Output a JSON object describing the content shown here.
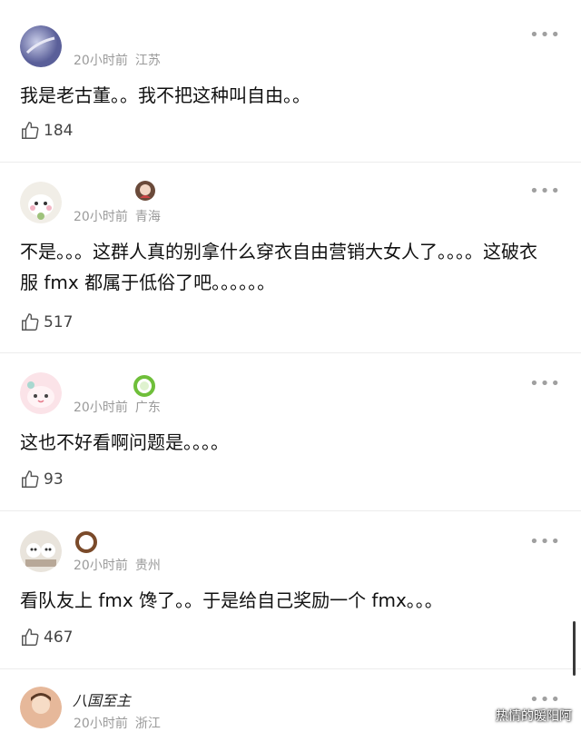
{
  "comments": [
    {
      "time": "20小时前",
      "location": "江苏",
      "text": "我是老古董。。我不把这种叫自由。。",
      "likes": "184",
      "more": "•••"
    },
    {
      "time": "20小时前",
      "location": "青海",
      "text": "不是。。。这群人真的别拿什么穿衣自由营销大女人了。。。。这破衣服 fmx 都属于低俗了吧。。。。。。",
      "likes": "517",
      "more": "•••"
    },
    {
      "time": "20小时前",
      "location": "广东",
      "text": "这也不好看啊问题是。。。。",
      "likes": "93",
      "more": "•••"
    },
    {
      "time": "20小时前",
      "location": "贵州",
      "text": "看队友上 fmx 馋了。。于是给自己奖励一个 fmx。。。",
      "likes": "467",
      "more": "•••"
    },
    {
      "time": "20小时前",
      "location": "浙江",
      "username": "八国至主",
      "more": "•••"
    }
  ],
  "watermark": "热情的暖阳阿",
  "colors": {
    "meta": "#9a9a9a",
    "text": "#111111",
    "divider": "#ececec"
  }
}
